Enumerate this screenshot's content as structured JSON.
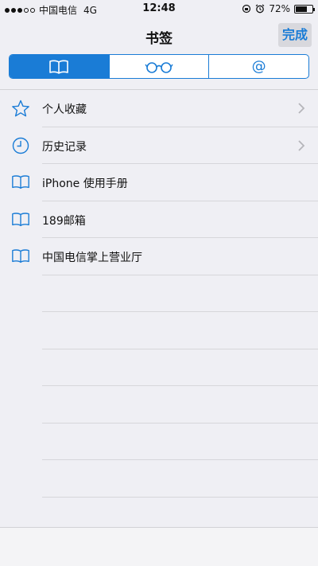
{
  "status_bar": {
    "carrier": "中国电信",
    "network": "4G",
    "time": "12:48",
    "battery": "72%",
    "battery_level": 0.72
  },
  "nav": {
    "title": "书签",
    "done_label": "完成"
  },
  "segments": [
    {
      "icon": "book-icon",
      "active": true
    },
    {
      "icon": "glasses-icon",
      "active": false
    },
    {
      "icon": "at-icon",
      "label": "@",
      "active": false
    }
  ],
  "list": {
    "items": [
      {
        "icon": "star-icon",
        "label": "个人收藏",
        "chevron": true
      },
      {
        "icon": "clock-icon",
        "label": "历史记录",
        "chevron": true
      },
      {
        "icon": "book-icon",
        "label": "iPhone 使用手册",
        "chevron": false
      },
      {
        "icon": "book-icon",
        "label": "189邮箱",
        "chevron": false
      },
      {
        "icon": "book-icon",
        "label": "中国电信掌上营业厅",
        "chevron": false
      }
    ]
  },
  "colors": {
    "accent": "#1a7cd6",
    "background": "#efeff4"
  }
}
